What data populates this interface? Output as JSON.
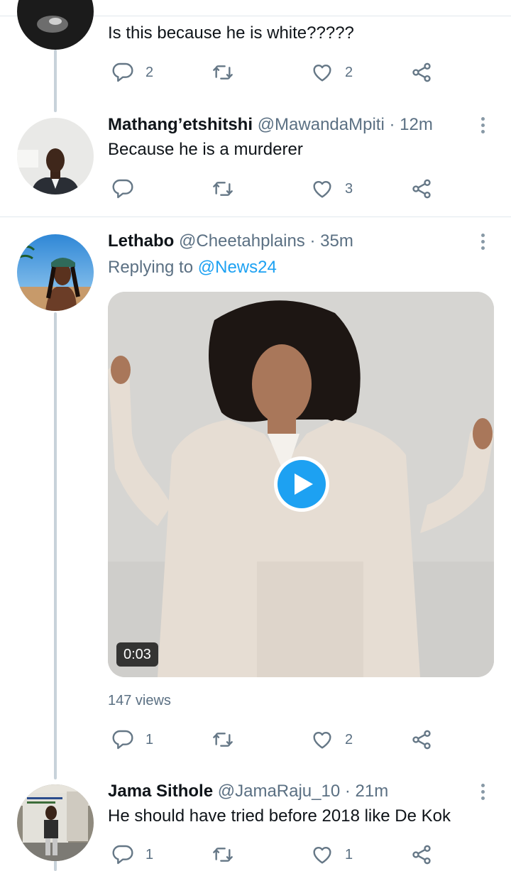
{
  "tweets": [
    {
      "text": "Is this because he is white?????",
      "replies": "2",
      "retweets": "",
      "likes": "2"
    },
    {
      "name": "Mathang’etshitshi",
      "handle": "@MawandaMpiti",
      "separator": "·",
      "time": "12m",
      "text": "Because he is a murderer",
      "replies": "",
      "retweets": "",
      "likes": "3"
    },
    {
      "name": "Lethabo",
      "handle": "@Cheetahplains",
      "separator": "·",
      "time": "35m",
      "replying_prefix": "Replying to ",
      "replying_to": "@News24",
      "video_duration": "0:03",
      "views": "147 views",
      "replies": "1",
      "retweets": "",
      "likes": "2"
    },
    {
      "name": "Jama Sithole",
      "handle": "@JamaRaju_10",
      "separator": "·",
      "time": "21m",
      "text": "He should have tried before 2018 like De Kok",
      "replies": "1",
      "retweets": "",
      "likes": "1"
    }
  ],
  "icons": {
    "reply": "reply-icon",
    "retweet": "retweet-icon",
    "like": "like-icon",
    "share": "share-icon",
    "more": "more-options-icon",
    "play": "play-icon"
  },
  "colors": {
    "accent": "#1da1f2",
    "secondary_text": "#5b7083",
    "icon": "#657786",
    "divider": "#e1e8ed",
    "thread_line": "#c8d2da"
  }
}
